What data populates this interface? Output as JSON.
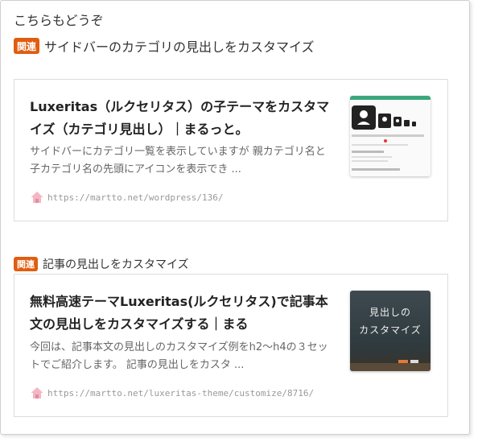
{
  "section": {
    "heading": "こちらもどうぞ"
  },
  "related_badge": "関連",
  "related_top": "サイドバーのカテゴリの見出しをカスタマイズ",
  "related_bottom": "記事の見出しをカスタマイズ",
  "cards": [
    {
      "title": "Luxeritas（ルクセリタス）の子テーマをカスタマイズ（カテゴリ見出し）｜まるっと。",
      "description": "サイドバーにカテゴリ一覧を表示していますが 親カテゴリ名と子カテゴリ名の先頭にアイコンを表示でき ...",
      "url": "https://martto.net/wordpress/136/",
      "thumbnail_icon": "screenshot-thumbnail"
    },
    {
      "title": "無料高速テーマLuxeritas(ルクセリタス)で記事本文の見出しをカスタマイズする｜まる",
      "description": "今回は、記事本文の見出しのカスタマイズ例をh2～h4の３セットでご紹介します。 記事の見出しをカスタ ...",
      "url": "https://martto.net/luxeritas-theme/customize/8716/",
      "thumbnail_text": [
        "見出しの",
        "カスタマイズ"
      ]
    }
  ],
  "colors": {
    "badge": "#e05d10",
    "url_text": "#999999",
    "border": "#dcdcdc"
  }
}
